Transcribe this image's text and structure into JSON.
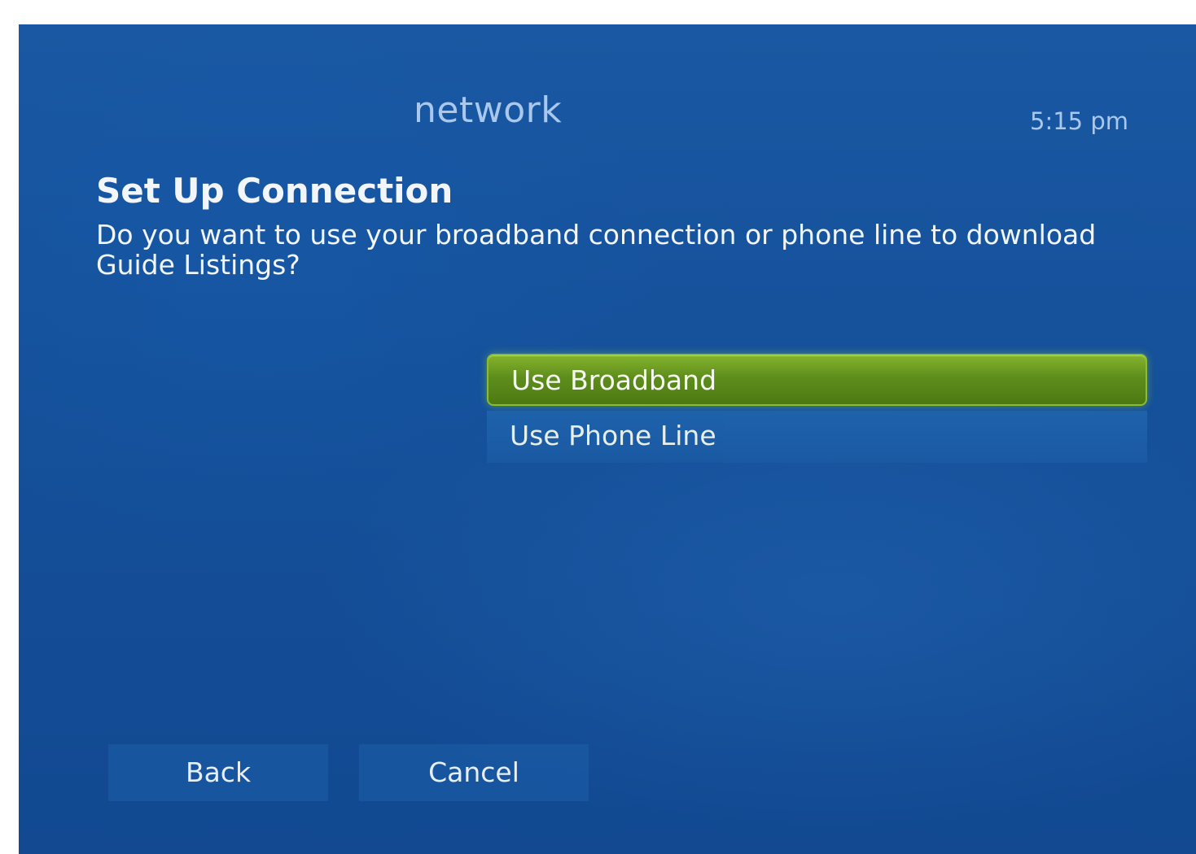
{
  "header": {
    "section_title": "network",
    "clock": "5:15 pm"
  },
  "page": {
    "heading": "Set Up Connection",
    "question": "Do you want to use your broadband connection or phone line to download Guide Listings?"
  },
  "options": [
    {
      "label": "Use Broadband",
      "selected": true
    },
    {
      "label": "Use Phone Line",
      "selected": false
    }
  ],
  "footer": {
    "back_label": "Back",
    "cancel_label": "Cancel"
  },
  "colors": {
    "background": "#15509a",
    "selected_option": "#5f8d1c",
    "header_text": "#a9c8ec"
  }
}
